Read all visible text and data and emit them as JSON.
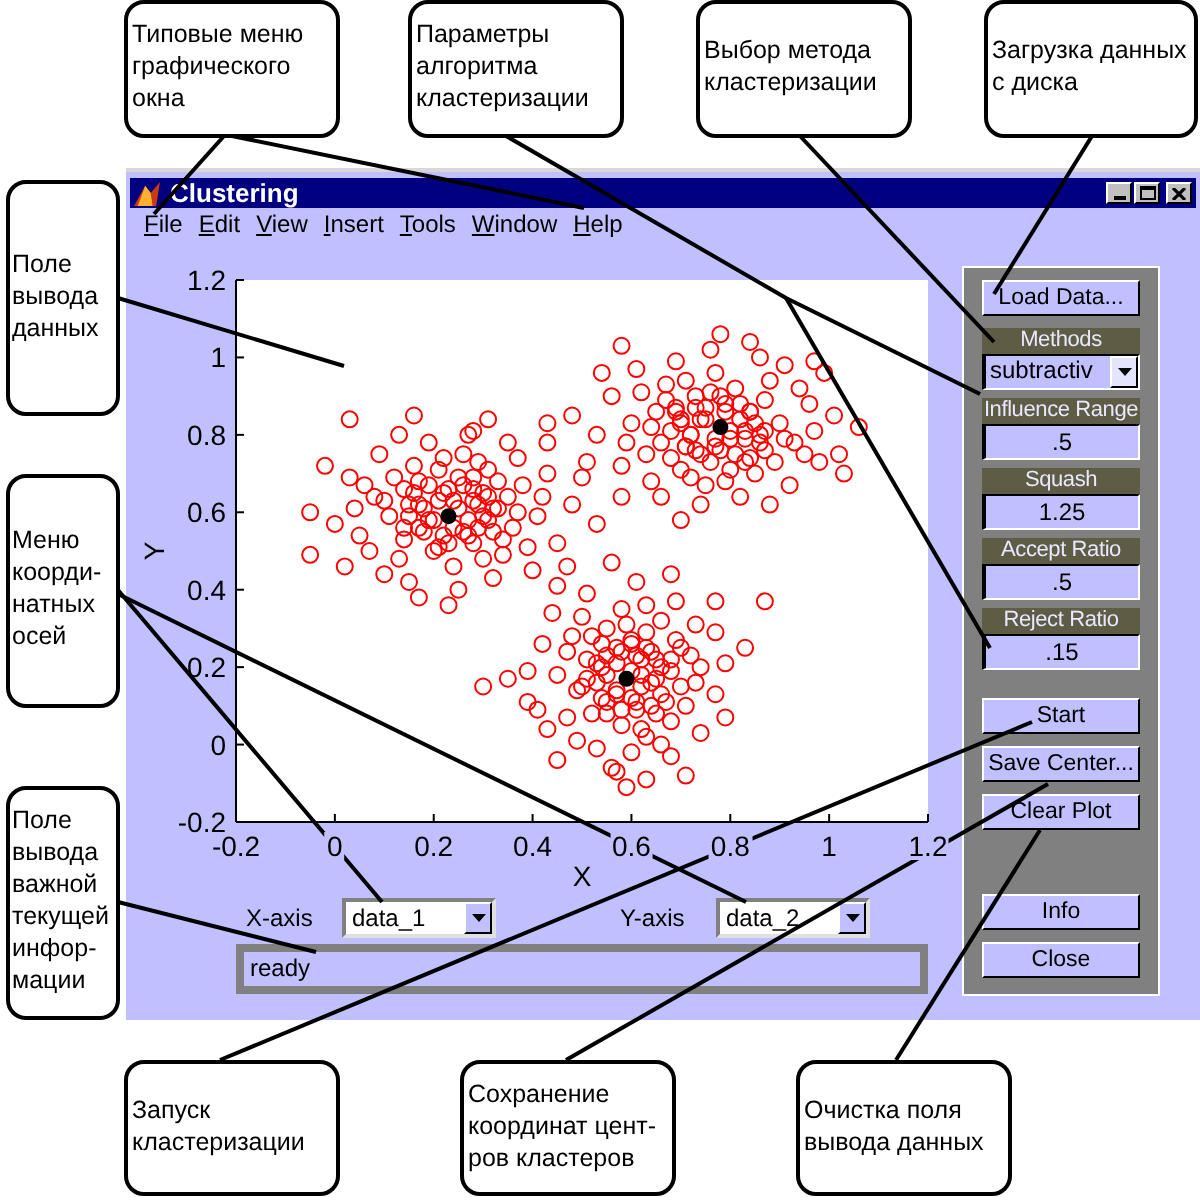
{
  "top_callouts": [
    "Типовые меню графического окна",
    "Параметры алгоритма кластеризации",
    "Выбор метода кластеризации",
    "Загрузка данных с диска"
  ],
  "window": {
    "title": "Clustering",
    "menu": [
      "File",
      "Edit",
      "View",
      "Insert",
      "Tools",
      "Window",
      "Help"
    ],
    "plot": {
      "chart_data": {
        "type": "scatter",
        "xlabel": "X",
        "ylabel": "Y",
        "xlim": [
          -0.2,
          1.2
        ],
        "ylim": [
          -0.2,
          1.2
        ],
        "xticks": [
          -0.2,
          0,
          0.2,
          0.4,
          0.6,
          0.8,
          1,
          1.2
        ],
        "yticks": [
          -0.2,
          0,
          0.2,
          0.4,
          0.6,
          0.8,
          1,
          1.2
        ],
        "series": [
          {
            "color": "#ff0000",
            "x": [
              0.21,
              0.27,
              0.3,
              0.17,
              0.33,
              0.14,
              0.25,
              0.28,
              0.2,
              0.36,
              0.11,
              0.31,
              0.16,
              0.38,
              0.08,
              0.24,
              0.34,
              0.13,
              0.41,
              0.05,
              0.26,
              0.19,
              0.37,
              0.09,
              0.43,
              0.03,
              0.32,
              0.15,
              0.45,
              0,
              0.23,
              0.29,
              0.18,
              0.26,
              0.22,
              0.32,
              0.14,
              0.35,
              0.12,
              0.29,
              0.21,
              0.39,
              0.07,
              0.42,
              0.04,
              0.27,
              0.13,
              0.35,
              0.4,
              0.1,
              0.25,
              0.48,
              -0.02,
              0.47,
              0.02,
              0.3,
              0.17,
              0.33,
              0.1,
              0.24,
              0.28,
              0.15,
              0.31,
              0.19,
              0.37,
              0.22,
              0.34,
              0.06,
              0.5,
              -0.05,
              0.23,
              0.43,
              0.17,
              0.53,
              0.31,
              -0.05,
              0.03,
              0.16,
              0.28,
              0.8,
              0.74,
              0.71,
              0.84,
              0.68,
              0.87,
              0.76,
              0.73,
              0.81,
              0.65,
              0.9,
              0.7,
              0.85,
              0.63,
              0.93,
              0.77,
              0.67,
              0.88,
              0.6,
              0.96,
              0.75,
              0.82,
              0.64,
              0.92,
              0.58,
              0.98,
              0.69,
              0.86,
              0.56,
              1.01,
              0.78,
              0.72,
              0.83,
              0.75,
              0.79,
              0.69,
              0.87,
              0.66,
              0.89,
              0.72,
              0.8,
              0.62,
              0.94,
              0.59,
              0.97,
              0.74,
              0.88,
              0.66,
              0.61,
              0.91,
              0.76,
              0.53,
              1.03,
              0.54,
              0.99,
              0.71,
              0.84,
              0.68,
              0.91,
              0.77,
              0.73,
              0.86,
              0.7,
              0.82,
              0.64,
              0.79,
              0.67,
              0.95,
              0.51,
              1.06,
              0.78,
              0.58,
              0.84,
              0.48,
              0.7,
              0.58,
              0.43,
              1.02,
              0.97,
              0.62,
              0.57,
              0.64,
              0.55,
              0.6,
              0.65,
              0.68,
              0.51,
              0.49,
              0.55,
              0.58,
              0.7,
              0.71,
              0.66,
              0.63,
              0.45,
              0.48,
              0.47,
              0.58,
              0.53,
              0.74,
              0.77,
              0.73,
              0.74,
              0.69,
              0.68,
              0.42,
              0.41,
              0.51,
              0.56,
              0.65,
              0.61,
              0.6,
              0.54,
              0.53,
              0.54,
              0.52,
              0.63,
              0.68,
              0.72,
              0.7,
              0.5,
              0.49,
              0.63,
              0.6,
              0.79,
              0.79,
              0.77,
              0.44,
              0.43,
              0.39,
              0.61,
              0.71,
              0.45,
              0.45,
              0.47,
              0.67,
              0.69,
              0.62,
              0.62,
              0.65,
              0.61,
              0.57,
              0.57,
              0.59,
              0.73,
              0.52,
              0.66,
              0.68,
              0.59,
              0.35,
              0.77,
              0.39,
              0.56,
              0.83,
              0.57,
              0.63,
              0.3,
              0.87,
              0.25,
              0.2,
              0.28,
              0.17,
              0.24,
              0.3,
              0.22,
              0.27,
              0.18,
              0.31,
              0.15,
              0.26,
              0.19,
              0.29,
              0.23,
              0.16,
              0.32,
              0.21,
              0.28,
              0.14,
              0.8,
              0.75,
              0.83,
              0.72,
              0.79,
              0.85,
              0.77,
              0.82,
              0.73,
              0.86,
              0.7,
              0.81,
              0.74,
              0.84,
              0.78,
              0.71,
              0.87,
              0.76,
              0.83,
              0.69,
              0.6,
              0.57,
              0.62,
              0.61,
              0.55,
              0.58,
              0.64,
              0.53,
              0.54,
              0.63,
              0.58,
              0.66,
              0.66,
              0.55,
              0.51,
              0.64,
              0.6,
              0.5,
              0.68,
              0.55
            ],
            "values": [
              0.63,
              0.58,
              0.65,
              0.56,
              0.61,
              0.66,
              0.69,
              0.52,
              0.5,
              0.56,
              0.59,
              0.71,
              0.72,
              0.67,
              0.64,
              0.46,
              0.49,
              0.48,
              0.59,
              0.54,
              0.75,
              0.78,
              0.74,
              0.75,
              0.7,
              0.69,
              0.43,
              0.42,
              0.52,
              0.57,
              0.66,
              0.62,
              0.61,
              0.55,
              0.54,
              0.55,
              0.53,
              0.64,
              0.69,
              0.73,
              0.71,
              0.51,
              0.5,
              0.64,
              0.61,
              0.8,
              0.8,
              0.78,
              0.45,
              0.44,
              0.4,
              0.62,
              0.72,
              0.46,
              0.46,
              0.48,
              0.68,
              0.68,
              0.63,
              0.63,
              0.66,
              0.62,
              0.58,
              0.58,
              0.6,
              0.74,
              0.53,
              0.67,
              0.69,
              0.6,
              0.36,
              0.78,
              0.38,
              0.57,
              0.84,
              0.49,
              0.84,
              0.85,
              0.81,
              0.79,
              0.84,
              0.77,
              0.86,
              0.81,
              0.76,
              0.73,
              0.9,
              0.92,
              0.86,
              0.83,
              0.71,
              0.7,
              0.75,
              0.78,
              0.96,
              0.93,
              0.94,
              0.83,
              0.88,
              0.67,
              0.64,
              0.68,
              0.67,
              0.72,
              0.73,
              0.99,
              1,
              0.9,
              0.85,
              0.76,
              0.8,
              0.81,
              0.87,
              0.88,
              0.87,
              0.89,
              0.78,
              0.73,
              0.69,
              0.71,
              0.91,
              0.92,
              0.78,
              0.81,
              0.62,
              0.62,
              0.64,
              0.97,
              0.98,
              1.02,
              0.8,
              0.7,
              0.96,
              0.96,
              0.94,
              0.74,
              0.74,
              0.79,
              0.79,
              0.76,
              0.8,
              0.84,
              0.84,
              0.82,
              0.68,
              0.89,
              0.75,
              0.73,
              0.82,
              1.06,
              0.64,
              1.04,
              0.85,
              0.58,
              1.03,
              0.83,
              0.75,
              0.99,
              0.15,
              0.21,
              0.24,
              0.11,
              0.27,
              0.08,
              0.19,
              0.22,
              0.14,
              0.3,
              0.05,
              0.25,
              0.1,
              0.32,
              0.02,
              0.18,
              0.28,
              0.07,
              0.35,
              -0.01,
              0.2,
              0.13,
              0.31,
              0.03,
              0.37,
              -0.03,
              0.26,
              0.09,
              0.39,
              -0.06,
              0.17,
              0.23,
              0.12,
              0.2,
              0.16,
              0.26,
              0.08,
              0.29,
              0.06,
              0.23,
              0.15,
              0.33,
              0.01,
              0.36,
              -0.02,
              0.21,
              0.07,
              0.29,
              0.34,
              0.04,
              0.19,
              0.42,
              -0.08,
              0.41,
              -0.04,
              0.24,
              0.11,
              0.27,
              0.04,
              0.18,
              0.22,
              0.09,
              0.25,
              0.13,
              0.31,
              0.16,
              0.28,
              0,
              0.44,
              -0.11,
              0.17,
              0.37,
              0.11,
              0.47,
              0.25,
              -0.07,
              -0.09,
              0.15,
              0.37,
              0.61,
              0.58,
              0.63,
              0.62,
              0.56,
              0.59,
              0.65,
              0.54,
              0.55,
              0.64,
              0.59,
              0.67,
              0.67,
              0.56,
              0.52,
              0.65,
              0.61,
              0.51,
              0.69,
              0.56,
              0.81,
              0.84,
              0.79,
              0.8,
              0.86,
              0.83,
              0.77,
              0.88,
              0.87,
              0.78,
              0.83,
              0.75,
              0.75,
              0.86,
              0.9,
              0.77,
              0.81,
              0.91,
              0.73,
              0.86,
              0.19,
              0.14,
              0.22,
              0.11,
              0.18,
              0.24,
              0.16,
              0.21,
              0.12,
              0.25,
              0.09,
              0.2,
              0.13,
              0.23,
              0.17,
              0.1,
              0.26,
              0.15,
              0.22,
              0.08
            ]
          },
          {
            "color": "#000000",
            "x": [
              0.23,
              0.78,
              0.59
            ],
            "values": [
              0.59,
              0.82,
              0.17
            ]
          }
        ]
      }
    },
    "axis_selectors": [
      {
        "label": "X-axis",
        "value": "data_1"
      },
      {
        "label": "Y-axis",
        "value": "data_2"
      }
    ],
    "status": "ready",
    "panel": {
      "load_button": "Load Data...",
      "method": {
        "label": "Methods",
        "value": "subtractiv"
      },
      "parameters": [
        {
          "label": "Influence Range",
          "value": ".5"
        },
        {
          "label": "Squash",
          "value": "1.25"
        },
        {
          "label": "Accept Ratio",
          "value": ".5"
        },
        {
          "label": "Reject Ratio",
          "value": ".15"
        }
      ],
      "action_buttons": [
        "Start",
        "Save Center...",
        "Clear Plot"
      ],
      "footer_buttons": [
        "Info",
        "Close"
      ]
    }
  },
  "side_callouts": [
    "Поле вывода данных",
    "Меню коорди-натных осей",
    "Поле вывода важной текущей инфор-мации"
  ],
  "bottom_callouts": [
    "Запуск кластеризации",
    "Сохранение координат цент-ров кластеров",
    "Очистка поля вывода данных"
  ]
}
